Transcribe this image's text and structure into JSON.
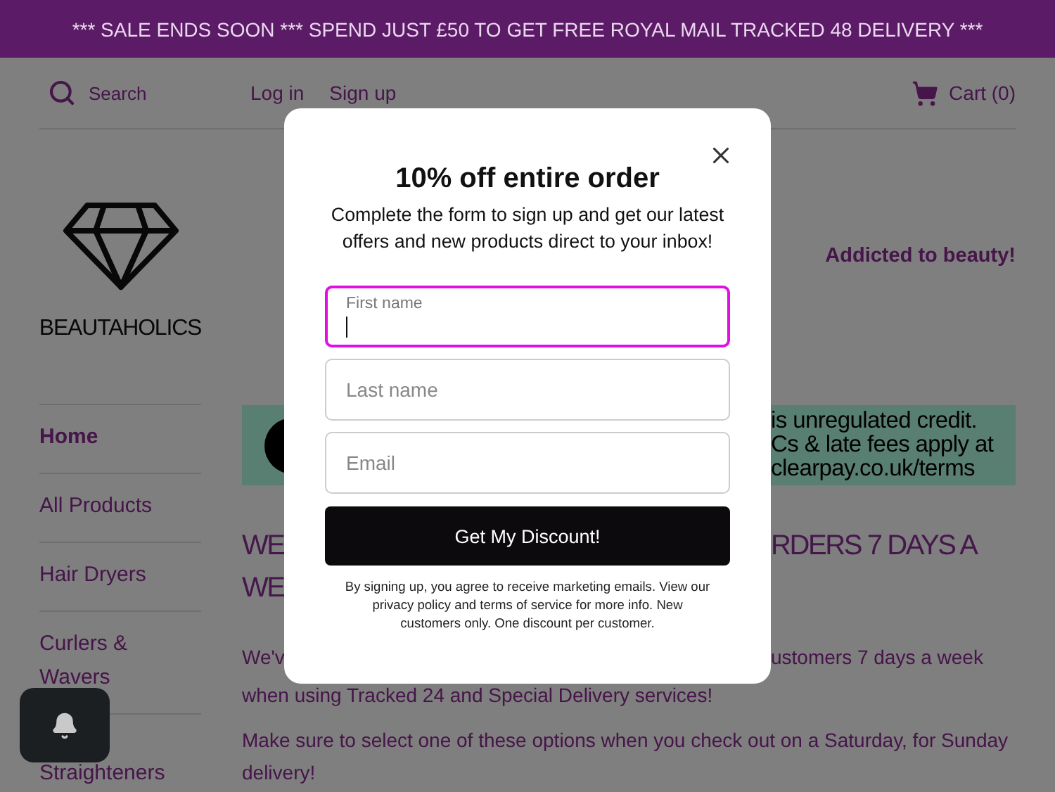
{
  "announcement": "*** SALE ENDS SOON *** SPEND JUST £50 TO GET FREE ROYAL MAIL TRACKED 48 DELIVERY ***",
  "header": {
    "search": {
      "placeholder": "Search"
    },
    "account_links": [
      "Log in",
      "Sign up"
    ],
    "cart": "Cart (0)"
  },
  "logo": {
    "text": "BEAUTAHOLICS"
  },
  "tagline": "Addicted to beauty!",
  "sidebar": {
    "items": [
      {
        "label": "Home",
        "selected": true
      },
      {
        "label": "All Products",
        "selected": false
      },
      {
        "label": "Hair Dryers",
        "selected": false
      },
      {
        "label": "Curlers & Wavers",
        "selected": false
      },
      {
        "label": "Straighteners",
        "selected": false
      }
    ]
  },
  "promo_banner": {
    "lines": [
      "is unregulated credit.",
      "Cs & late fees apply at",
      "clearpay.co.uk/terms"
    ]
  },
  "content": {
    "heading": {
      "line_1_start": "WE",
      "line_1_end": "RDERS 7 DAYS A",
      "line_2_start": "WE"
    },
    "paragraph_1": {
      "line_1_start": "We'v",
      "line_1_end": "ustomers 7 days a week",
      "line_2": "when using Tracked 24 and Special Delivery services!"
    },
    "paragraph_2": "Make sure to select one of these options when you check out on a Saturday, for Sunday delivery!"
  },
  "modal": {
    "title": "10% off entire order",
    "subtitle": "Complete the form to sign up and get our latest offers and new products direct to your inbox!",
    "fields": [
      {
        "label": "First name",
        "focused": true
      },
      {
        "placeholder": "Last name",
        "focused": false
      },
      {
        "placeholder": "Email",
        "focused": false
      }
    ],
    "button": "Get My Discount!",
    "disclaimer": "By signing up, you agree to receive marketing emails. View our privacy policy and terms of service for more info. New customers only. One discount per customer."
  }
}
